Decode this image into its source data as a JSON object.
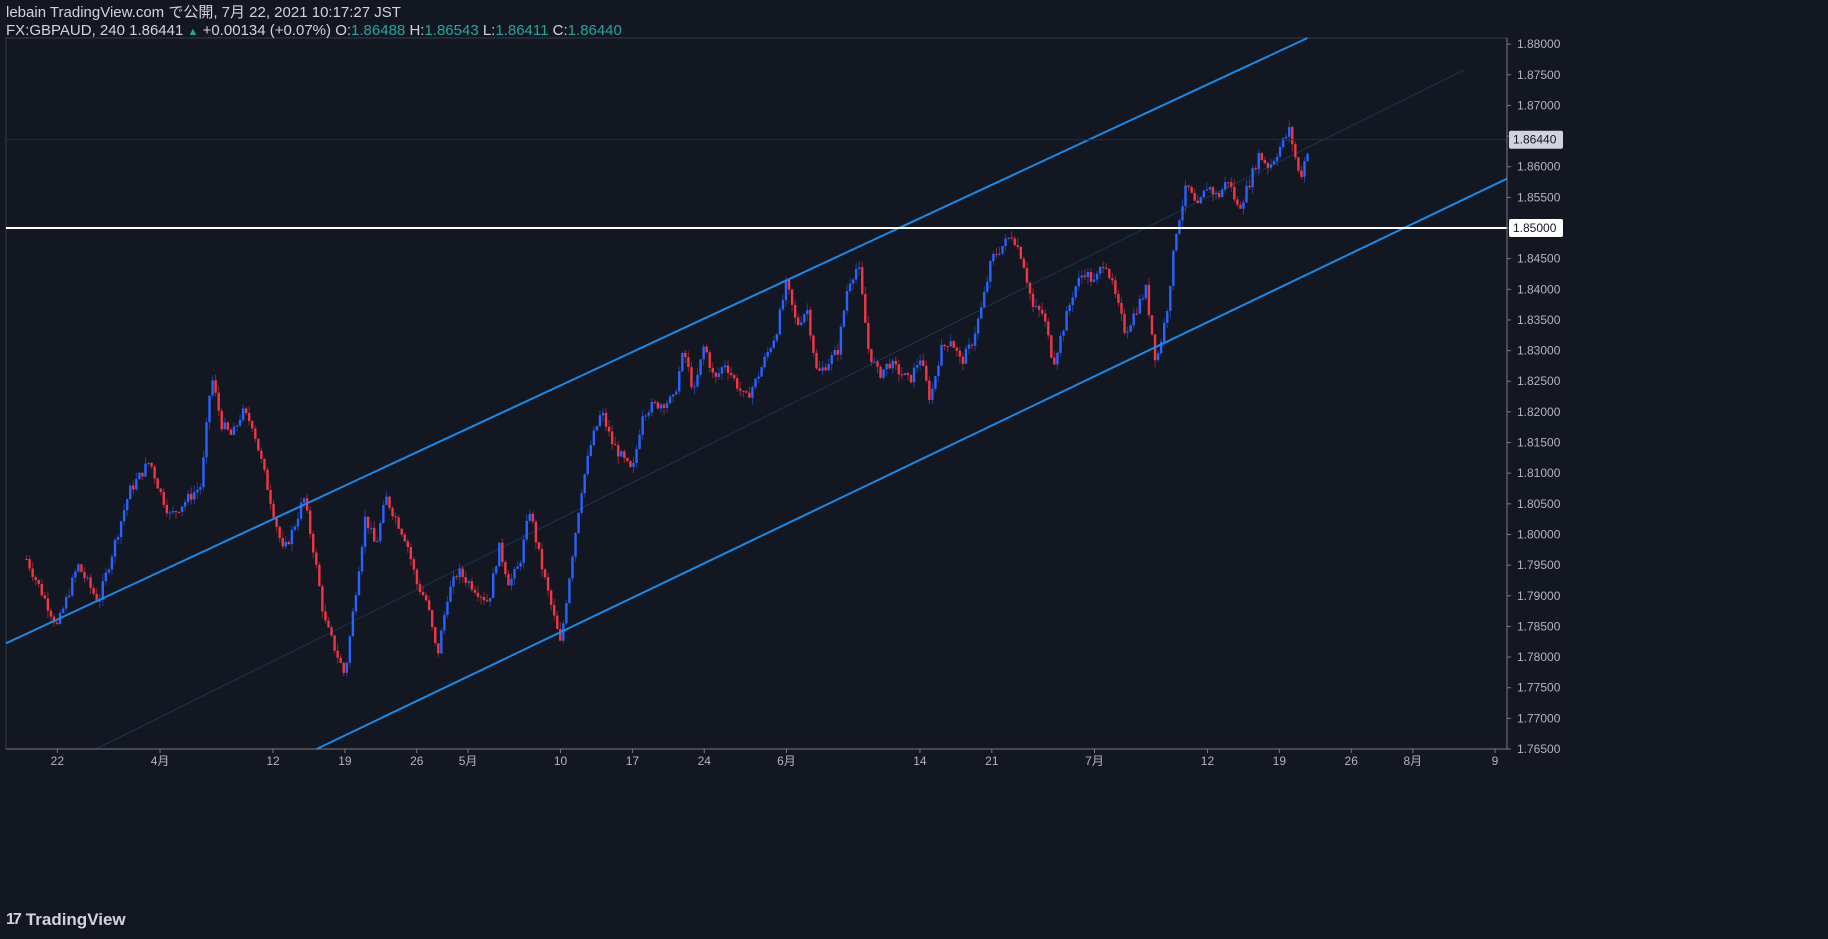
{
  "header": {
    "line1": "lebain TradingView.com で公開, 7月 22, 2021 10:17:27 JST",
    "symbol": "FX:GBPAUD, 240",
    "last": "1.86441",
    "arrow": "▲",
    "change": "+0.00134 (+0.07%)",
    "o_label": "O:",
    "o_value": "1.86488",
    "h_label": "H:",
    "h_value": "1.86543",
    "l_label": "L:",
    "l_value": "1.86411",
    "c_label": "C:",
    "c_value": "1.86440"
  },
  "brand": {
    "logo": "17",
    "name": "TradingView"
  },
  "colors": {
    "background": "#131722",
    "up": "#2962ff",
    "down": "#f23645",
    "line": "#1e88e5",
    "hline": "#ffffff",
    "text": "#b2b5be"
  },
  "chart_data": {
    "type": "candlestick",
    "title": "FX:GBPAUD, 240",
    "yrange": [
      1.765,
      1.881
    ],
    "y_ticks": [
      "1.88000",
      "1.87500",
      "1.87000",
      "1.86500",
      "1.86000",
      "1.85500",
      "1.85000",
      "1.84500",
      "1.84000",
      "1.83500",
      "1.83000",
      "1.82500",
      "1.82000",
      "1.81500",
      "1.81000",
      "1.80500",
      "1.80000",
      "1.79500",
      "1.79000",
      "1.78500",
      "1.78000",
      "1.77500",
      "1.77000",
      "1.76500"
    ],
    "x_ticks": [
      "22",
      "4月",
      "12",
      "19",
      "26",
      "5月",
      "10",
      "17",
      "24",
      "6月",
      "14",
      "21",
      "7月",
      "12",
      "19",
      "26",
      "8月",
      "9"
    ],
    "last_price_label": "1.86440",
    "hline_label": "1.85000",
    "horizontal_line": 1.85,
    "channel": {
      "upper": {
        "from": {
          "date": "2021-03-19",
          "price": 1.7838
        },
        "to": {
          "date": "2021-07-22",
          "price": 1.8812
        }
      },
      "lower": {
        "from": {
          "date": "2021-04-16",
          "price": 1.7648
        },
        "to": {
          "date": "2021-08-06",
          "price": 1.8547
        }
      },
      "mid": {
        "from": {
          "date": "2021-03-26",
          "price": 1.7652
        },
        "to": {
          "date": "2021-08-06",
          "price": 1.8758
        }
      }
    },
    "path": [
      [
        "2021-03-19",
        1.796
      ],
      [
        "2021-03-22",
        1.785
      ],
      [
        "2021-03-24",
        1.795
      ],
      [
        "2021-03-26",
        1.789
      ],
      [
        "2021-03-29",
        1.807
      ],
      [
        "2021-03-31",
        1.812
      ],
      [
        "2021-04-01",
        1.807
      ],
      [
        "2021-04-02",
        1.803
      ],
      [
        "2021-04-05",
        1.808
      ],
      [
        "2021-04-06",
        1.826
      ],
      [
        "2021-04-07",
        1.818
      ],
      [
        "2021-04-08",
        1.816
      ],
      [
        "2021-04-09",
        1.82
      ],
      [
        "2021-04-10",
        1.818
      ],
      [
        "2021-04-12",
        1.804
      ],
      [
        "2021-04-13",
        1.797
      ],
      [
        "2021-04-14",
        1.801
      ],
      [
        "2021-04-15",
        1.806
      ],
      [
        "2021-04-16",
        1.797
      ],
      [
        "2021-04-17",
        1.786
      ],
      [
        "2021-04-19",
        1.777
      ],
      [
        "2021-04-20",
        1.79
      ],
      [
        "2021-04-21",
        1.803
      ],
      [
        "2021-04-22",
        1.798
      ],
      [
        "2021-04-23",
        1.806
      ],
      [
        "2021-04-25",
        1.799
      ],
      [
        "2021-04-26",
        1.792
      ],
      [
        "2021-04-27",
        1.789
      ],
      [
        "2021-04-28",
        1.78
      ],
      [
        "2021-04-29",
        1.79
      ],
      [
        "2021-04-30",
        1.794
      ],
      [
        "2021-05-03",
        1.789
      ],
      [
        "2021-05-04",
        1.798
      ],
      [
        "2021-05-05",
        1.792
      ],
      [
        "2021-05-06",
        1.795
      ],
      [
        "2021-05-07",
        1.804
      ],
      [
        "2021-05-08",
        1.796
      ],
      [
        "2021-05-10",
        1.782
      ],
      [
        "2021-05-11",
        1.795
      ],
      [
        "2021-05-12",
        1.807
      ],
      [
        "2021-05-13",
        1.815
      ],
      [
        "2021-05-14",
        1.82
      ],
      [
        "2021-05-15",
        1.815
      ],
      [
        "2021-05-17",
        1.81
      ],
      [
        "2021-05-18",
        1.82
      ],
      [
        "2021-05-19",
        1.821
      ],
      [
        "2021-05-21",
        1.822
      ],
      [
        "2021-05-22",
        1.83
      ],
      [
        "2021-05-23",
        1.823
      ],
      [
        "2021-05-24",
        1.831
      ],
      [
        "2021-05-25",
        1.825
      ],
      [
        "2021-05-26",
        1.828
      ],
      [
        "2021-05-28",
        1.822
      ],
      [
        "2021-05-29",
        1.825
      ],
      [
        "2021-05-31",
        1.833
      ],
      [
        "2021-06-01",
        1.841
      ],
      [
        "2021-06-02",
        1.834
      ],
      [
        "2021-06-03",
        1.837
      ],
      [
        "2021-06-04",
        1.826
      ],
      [
        "2021-06-06",
        1.83
      ],
      [
        "2021-06-07",
        1.841
      ],
      [
        "2021-06-08",
        1.844
      ],
      [
        "2021-06-09",
        1.83
      ],
      [
        "2021-06-10",
        1.826
      ],
      [
        "2021-06-11",
        1.828
      ],
      [
        "2021-06-13",
        1.825
      ],
      [
        "2021-06-14",
        1.829
      ],
      [
        "2021-06-15",
        1.822
      ],
      [
        "2021-06-16",
        1.83
      ],
      [
        "2021-06-17",
        1.832
      ],
      [
        "2021-06-18",
        1.828
      ],
      [
        "2021-06-19",
        1.831
      ],
      [
        "2021-06-20",
        1.837
      ],
      [
        "2021-06-21",
        1.845
      ],
      [
        "2021-06-22",
        1.847
      ],
      [
        "2021-06-23",
        1.849
      ],
      [
        "2021-06-24",
        1.845
      ],
      [
        "2021-06-25",
        1.837
      ],
      [
        "2021-06-26",
        1.836
      ],
      [
        "2021-06-27",
        1.828
      ],
      [
        "2021-06-28",
        1.834
      ],
      [
        "2021-06-29",
        1.84
      ],
      [
        "2021-06-30",
        1.843
      ],
      [
        "2021-07-01",
        1.841
      ],
      [
        "2021-07-02",
        1.845
      ],
      [
        "2021-07-03",
        1.839
      ],
      [
        "2021-07-04",
        1.833
      ],
      [
        "2021-07-06",
        1.84
      ],
      [
        "2021-07-07",
        1.828
      ],
      [
        "2021-07-08",
        1.836
      ],
      [
        "2021-07-09",
        1.85
      ],
      [
        "2021-07-10",
        1.857
      ],
      [
        "2021-07-11",
        1.853
      ],
      [
        "2021-07-12",
        1.857
      ],
      [
        "2021-07-13",
        1.855
      ],
      [
        "2021-07-14",
        1.858
      ],
      [
        "2021-07-15",
        1.853
      ],
      [
        "2021-07-16",
        1.857
      ],
      [
        "2021-07-17",
        1.862
      ],
      [
        "2021-07-18",
        1.86
      ],
      [
        "2021-07-19",
        1.863
      ],
      [
        "2021-07-20",
        1.866
      ],
      [
        "2021-07-21",
        1.858
      ],
      [
        "2021-07-22",
        1.8644
      ]
    ]
  }
}
